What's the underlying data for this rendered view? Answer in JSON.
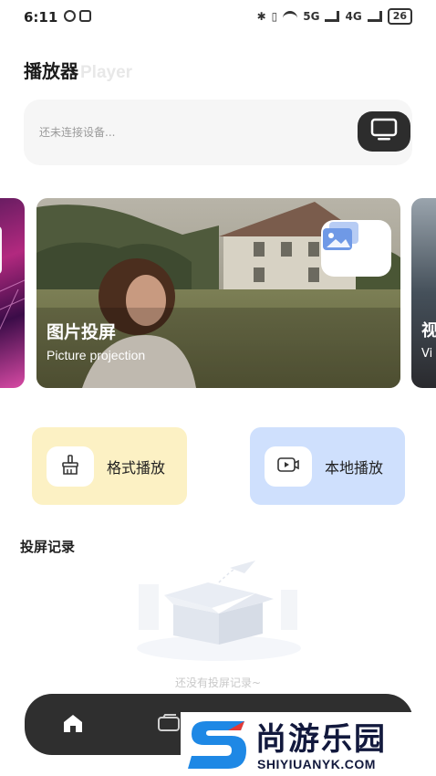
{
  "status_bar": {
    "time": "6:11",
    "net_1": "5G",
    "net_2": "4G",
    "battery": "26"
  },
  "header": {
    "title_cn": "播放器",
    "title_en": "Player"
  },
  "connect": {
    "status_text": "还未连接设备..."
  },
  "carousel": {
    "main_card": {
      "title": "图片投屏",
      "subtitle": "Picture projection"
    },
    "next_card": {
      "title": "视",
      "subtitle": "Vi"
    }
  },
  "functions": {
    "format_play": "格式播放",
    "local_play": "本地播放"
  },
  "history": {
    "title": "投屏记录",
    "empty_text": "还没有投屏记录~"
  },
  "tabs": {
    "icons": [
      "home-icon",
      "screen-icon",
      "circle-icon",
      "user-icon"
    ]
  },
  "watermark": {
    "brand_cn": "尚游乐园",
    "brand_en": "SHIYIUANYK.COM"
  },
  "colors": {
    "format_bg": "#fcf1c4",
    "local_bg": "#cfe0fd",
    "tabbar_bg": "#2f2f2f",
    "watermark_blue": "#1e88e5"
  }
}
